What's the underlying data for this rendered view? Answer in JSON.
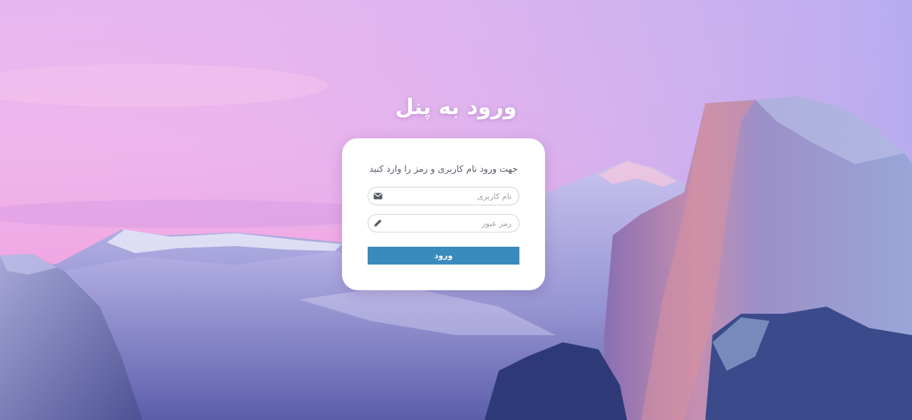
{
  "page": {
    "title": "ورود به پنل"
  },
  "login": {
    "subtitle": "جهت ورود نام کاربری و رمز را وارد کنید",
    "username_placeholder": "نام کاربری",
    "username_icon": "envelope-icon",
    "password_placeholder": "رمز عبور",
    "password_icon": "pencil-icon",
    "submit_label": "ورود"
  },
  "colors": {
    "button": "#3a8bbd",
    "card": "#ffffff",
    "title_text": "#ffffff"
  }
}
